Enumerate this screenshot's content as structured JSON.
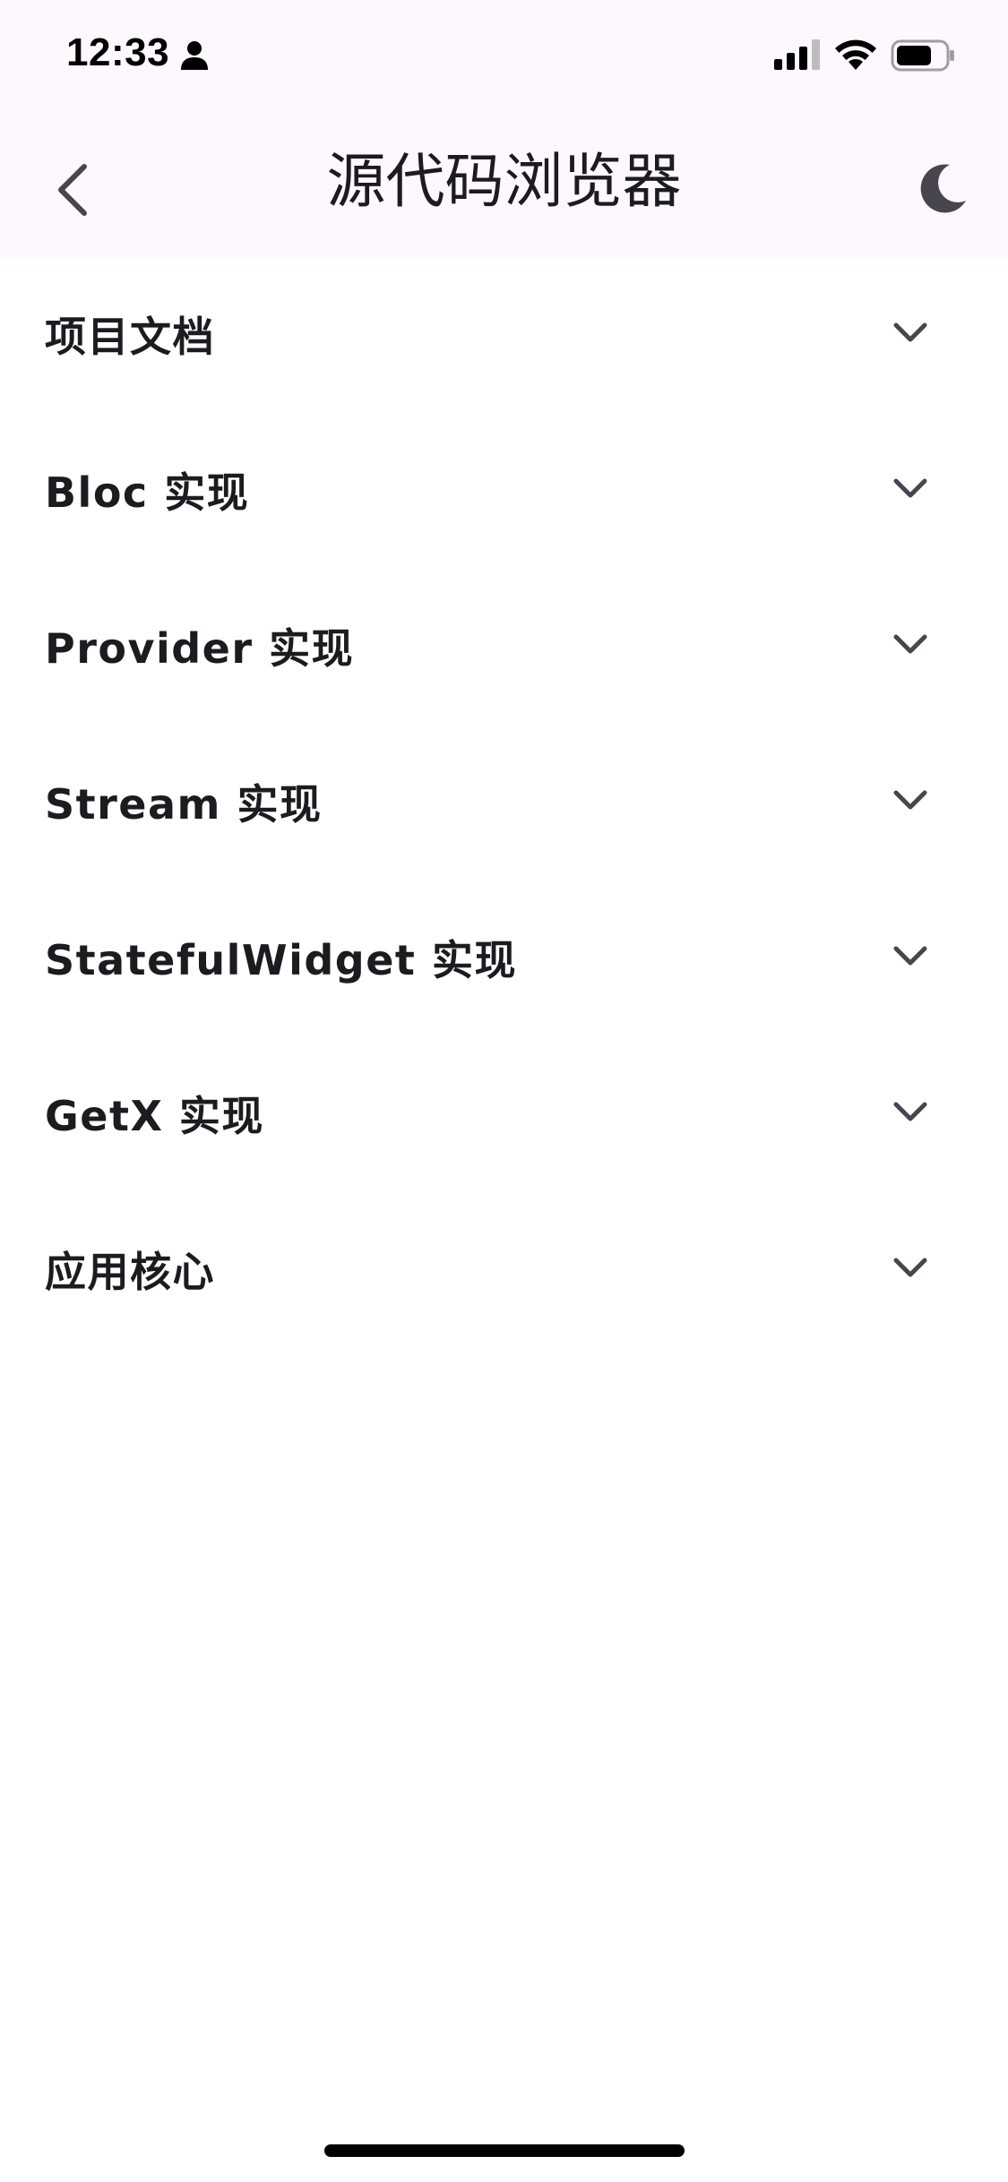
{
  "status_bar": {
    "time": "12:33",
    "icons": [
      "person-icon",
      "cellular-signal-icon",
      "wifi-icon",
      "battery-icon"
    ]
  },
  "app_bar": {
    "title": "源代码浏览器",
    "back_icon": "chevron-left-icon",
    "theme_icon": "moon-icon"
  },
  "sections": [
    {
      "label": "项目文档",
      "icon": "chevron-down-icon"
    },
    {
      "label": "Bloc 实现",
      "icon": "chevron-down-icon"
    },
    {
      "label": "Provider 实现",
      "icon": "chevron-down-icon"
    },
    {
      "label": "Stream 实现",
      "icon": "chevron-down-icon"
    },
    {
      "label": "StatefulWidget 实现",
      "icon": "chevron-down-icon"
    },
    {
      "label": "GetX 实现",
      "icon": "chevron-down-icon"
    },
    {
      "label": "应用核心",
      "icon": "chevron-down-icon"
    }
  ],
  "colors": {
    "app_bar_background": "#fdf7fe",
    "background": "#ffffff",
    "text": "#1d1b20",
    "icon": "#49454f"
  }
}
